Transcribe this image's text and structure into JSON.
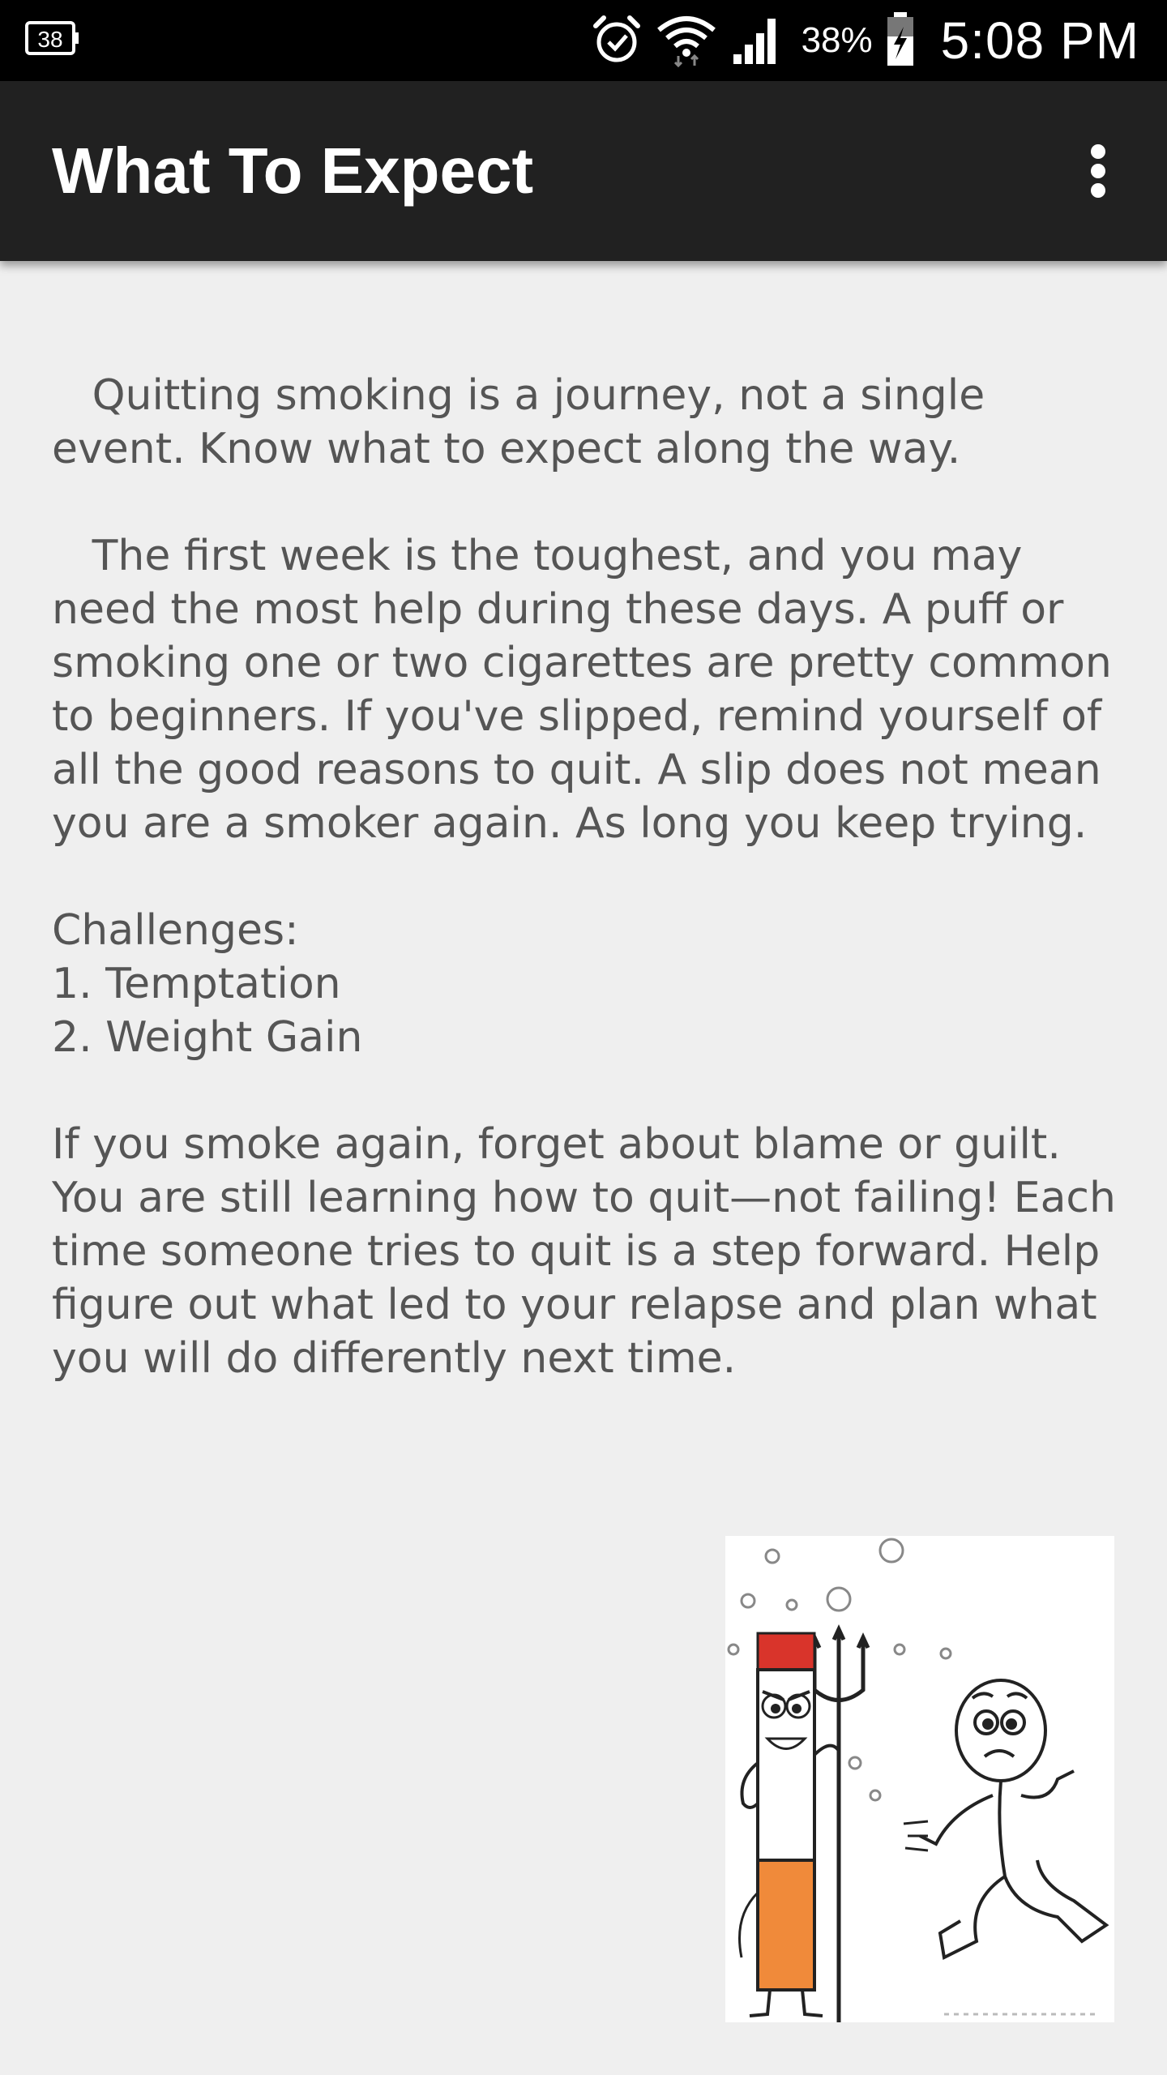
{
  "status_bar": {
    "notification_badge": "38",
    "battery_percent": "38%",
    "time": "5:08 PM",
    "icons": [
      "notification-count-icon",
      "alarm-icon",
      "wifi-icon",
      "cellular-signal-icon",
      "battery-charging-icon"
    ]
  },
  "app_bar": {
    "title": "What To Expect",
    "overflow_icon": "more-vert-icon"
  },
  "content": {
    "paragraph_1": "   Quitting smoking is a journey, not a single event. Know what to expect along the way.",
    "paragraph_2": "   The first week is the toughest, and you may need the most help during these days. A puff or smoking one or two cigarettes are pretty common to beginners. If you've slipped, remind yourself of all the good reasons to quit. A slip does not mean you are a smoker again. As long you keep trying.",
    "challenges_heading": "Challenges:",
    "challenges": [
      "1. Temptation",
      "2. Weight Gain"
    ],
    "paragraph_3": "If you smoke again, forget about blame or guilt. You are still learning how to quit—not failing! Each time someone tries to quit is a step forward. Help figure out what led to your relapse and plan what you will do differently next time."
  },
  "illustration": {
    "subject": "cigarette-devil-chasing-person-illustration"
  },
  "colors": {
    "status_bar_bg": "#000000",
    "app_bar_bg": "#212121",
    "page_bg": "#efefef",
    "body_text": "#555555",
    "cigarette_filter": "#f08a3a",
    "cigarette_tip": "#d9342b"
  }
}
